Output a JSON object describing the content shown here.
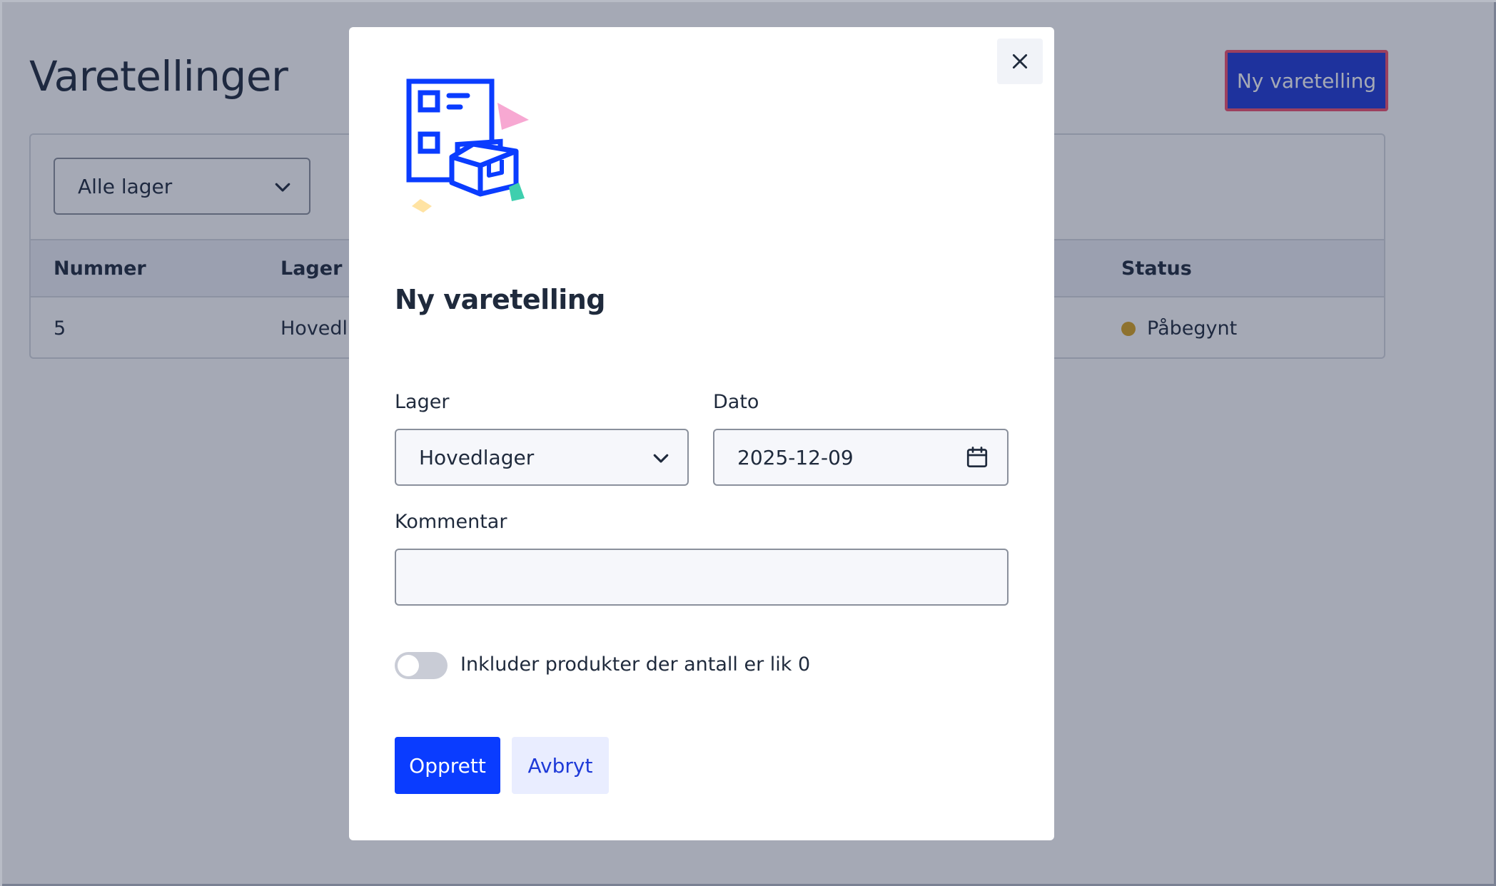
{
  "page": {
    "title": "Varetellinger",
    "new_button_label": "Ny varetelling",
    "filter": {
      "selected": "Alle lager"
    },
    "table": {
      "columns": [
        "Nummer",
        "Lager",
        "Status"
      ],
      "rows": [
        {
          "nummer": "5",
          "lager": "Hovedl",
          "status": "Påbegynt",
          "status_color": "#d9a31f"
        }
      ]
    }
  },
  "modal": {
    "title": "Ny varetelling",
    "close_icon": "close-icon",
    "illustration_icon": "inventory-count-illustration",
    "lager": {
      "label": "Lager",
      "value": "Hovedlager"
    },
    "dato": {
      "label": "Dato",
      "value": "2025-12-09"
    },
    "kommentar": {
      "label": "Kommentar",
      "value": "",
      "placeholder": ""
    },
    "toggle": {
      "label": "Inkluder produkter der antall er lik 0",
      "checked": false
    },
    "create_label": "Opprett",
    "cancel_label": "Avbryt"
  },
  "colors": {
    "primary": "#0a3cff",
    "header_button": "#1e3ad8",
    "highlight_border": "#f0506e",
    "status_in_progress": "#d9a31f"
  }
}
